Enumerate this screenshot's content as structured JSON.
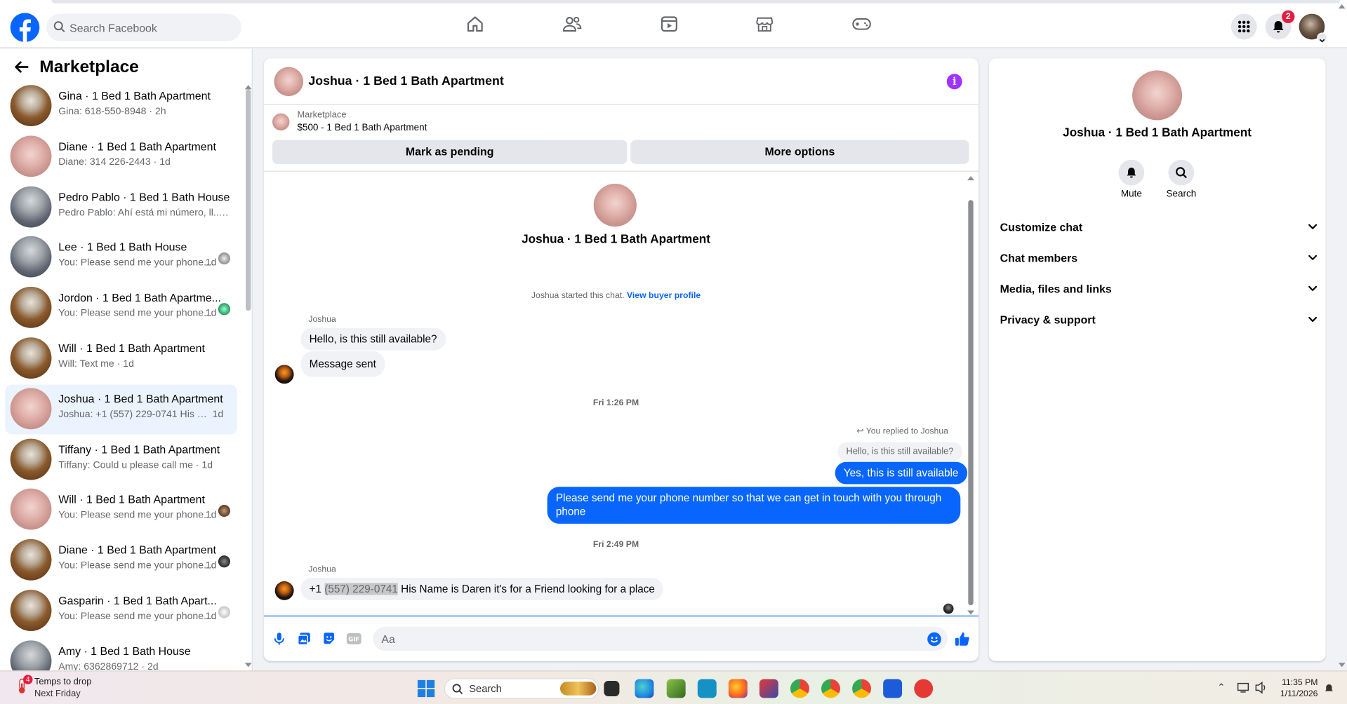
{
  "topnav": {
    "search_placeholder": "Search Facebook",
    "notifications_count": "2",
    "icons": [
      "home-icon",
      "friends-icon",
      "video-icon",
      "marketplace-icon",
      "gaming-icon",
      "menu-grid-icon",
      "bell-icon",
      "account-avatar"
    ]
  },
  "sidebar": {
    "title": "Marketplace",
    "conversations": [
      {
        "name": "Gina · 1 Bed 1 Bath Apartment",
        "snippet": "Gina: 618-550-8948 · 2h",
        "time": "",
        "thumb": "wood",
        "mini": ""
      },
      {
        "name": "Diane · 1 Bed 1 Bath Apartment",
        "snippet": "Diane: 314 226-2443 · 1d",
        "time": "",
        "thumb": "pink",
        "mini": ""
      },
      {
        "name": "Pedro Pablo · 1 Bed 1 Bath House",
        "snippet": "Pedro Pablo: Ahí está mi número, ll... · 1d",
        "time": "",
        "thumb": "grey",
        "mini": ""
      },
      {
        "name": "Lee · 1 Bed 1 Bath House",
        "snippet": "You: Please send me your phone...",
        "time": "1d",
        "thumb": "grey",
        "mini": "grey"
      },
      {
        "name": "Jordon · 1 Bed 1 Bath Apartme...",
        "snippet": "You: Please send me your phone...",
        "time": "1d",
        "thumb": "wood",
        "mini": "teal"
      },
      {
        "name": "Will · 1 Bed 1 Bath Apartment",
        "snippet": "Will: Text me · 1d",
        "time": "",
        "thumb": "wood",
        "mini": ""
      },
      {
        "name": "Joshua · 1 Bed 1 Bath Apartment",
        "snippet": "Joshua: +1 (557) 229-0741 His Na...",
        "time": "1d",
        "thumb": "pink",
        "mini": "",
        "active": true
      },
      {
        "name": "Tiffany · 1 Bed 1 Bath Apartment",
        "snippet": "Tiffany: Could u please call me · 1d",
        "time": "",
        "thumb": "wood",
        "mini": ""
      },
      {
        "name": "Will · 1 Bed 1 Bath Apartment",
        "snippet": "You: Please send me your phone...",
        "time": "1d",
        "thumb": "pink",
        "mini": "brown"
      },
      {
        "name": "Diane · 1 Bed 1 Bath Apartment",
        "snippet": "You: Please send me your phone...",
        "time": "1d",
        "thumb": "wood",
        "mini": "dark"
      },
      {
        "name": "Gasparin · 1 Bed 1 Bath Apart...",
        "snippet": "You: Please send me your phone...",
        "time": "1d",
        "thumb": "wood",
        "mini": "light"
      },
      {
        "name": "Amy · 1 Bed 1 Bath House",
        "snippet": "Amy: 6362869712 · 2d",
        "time": "",
        "thumb": "grey",
        "mini": ""
      }
    ]
  },
  "chat": {
    "title": "Joshua · 1 Bed 1 Bath Apartment",
    "marketplace_label": "Marketplace",
    "listing": "$500 - 1 Bed 1 Bath Apartment",
    "mark_pending": "Mark as pending",
    "more_options": "More options",
    "intro_title": "Joshua · 1 Bed 1 Bath Apartment",
    "started_text": "Joshua started this chat.",
    "view_profile": "View buyer profile",
    "sender1": "Joshua",
    "msg1": "Hello, is this still available?",
    "msg2": "Message sent",
    "time1": "Fri 1:26 PM",
    "replied_to": "You replied to Joshua",
    "quoted": "Hello, is this still available?",
    "msg3": "Yes, this is still available",
    "msg4_line1": "Please send me your phone  number so that we can get in touch with you through",
    "msg4_line2": "phone",
    "time2": "Fri 2:49 PM",
    "sender2": "Joshua",
    "msg5_prefix": "+1 ",
    "msg5_highlight": "(557) 229-0741",
    "msg5_rest": " His Name is Daren it's for a Friend looking for a place",
    "composer_placeholder": "Aa"
  },
  "rightpanel": {
    "title": "Joshua · 1 Bed 1 Bath Apartment",
    "mute": "Mute",
    "search": "Search",
    "rows": [
      "Customize chat",
      "Chat members",
      "Media, files and links",
      "Privacy & support"
    ]
  },
  "taskbar": {
    "weather_badge": "4",
    "weather_title": "Temps to drop",
    "weather_sub": "Next Friday",
    "search": "Search",
    "time": "11:35 PM",
    "date": "1/11/2026"
  },
  "colors": {
    "accent": "#0866ff",
    "info": "#a033ff",
    "active_row": "#ebf3ff",
    "badge": "#e41e3f"
  }
}
